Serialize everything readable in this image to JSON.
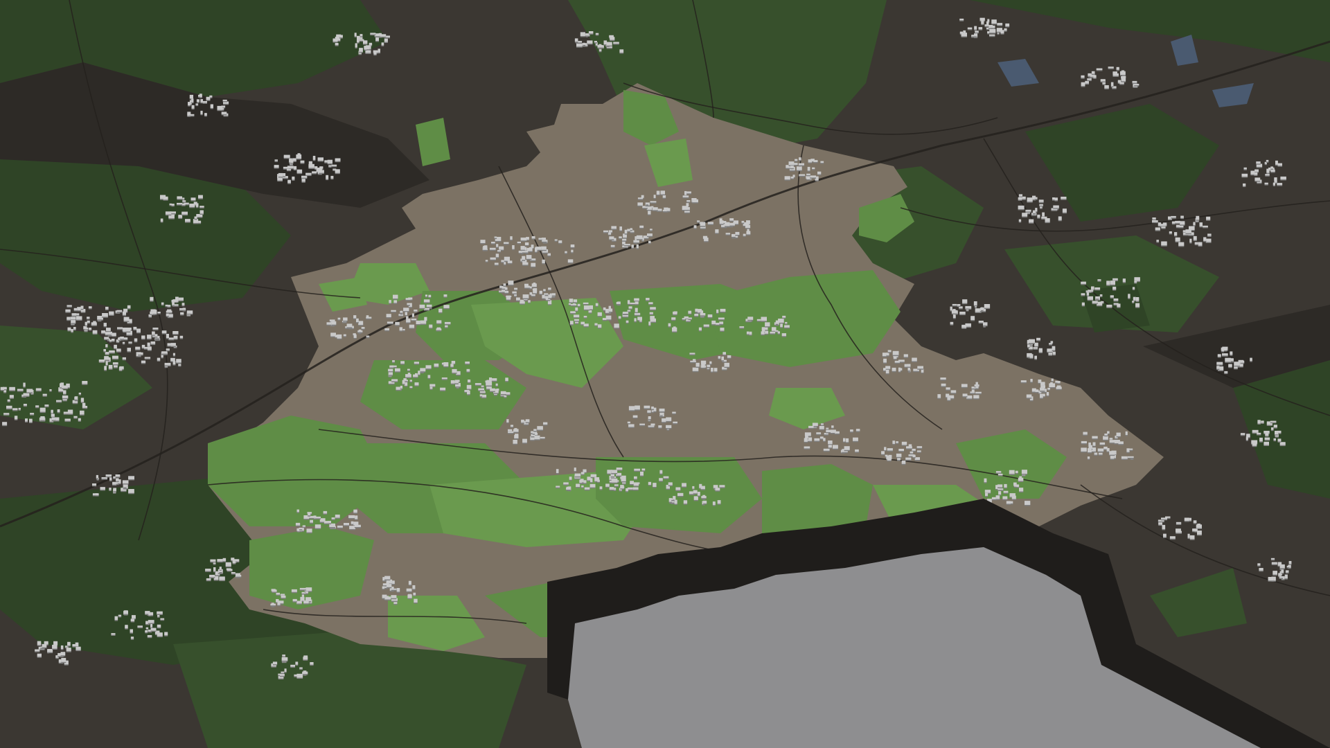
{
  "scene": {
    "type": "3d-city-map-render",
    "view": "oblique-aerial"
  },
  "colors": {
    "context_ground": "#3b3732",
    "context_ground_dark": "#2d2a26",
    "context_forest": "#37502c",
    "context_forest_dark": "#2f4426",
    "highlight_ground": "#7c7264",
    "highlight_green": "#5f8d46",
    "highlight_green_light": "#6a9a4e",
    "water": "#4a5a70",
    "road": "#24211d",
    "building_light": "#c9c9c9",
    "building_shadow": "#7f7f7f",
    "cutout_wall": "#1f1d1b",
    "cutout_floor": "#8e8e90"
  },
  "layers": [
    "context-ground",
    "context-forest",
    "water",
    "highlight-district",
    "green-areas",
    "roads",
    "buildings",
    "terrain-cutout"
  ]
}
